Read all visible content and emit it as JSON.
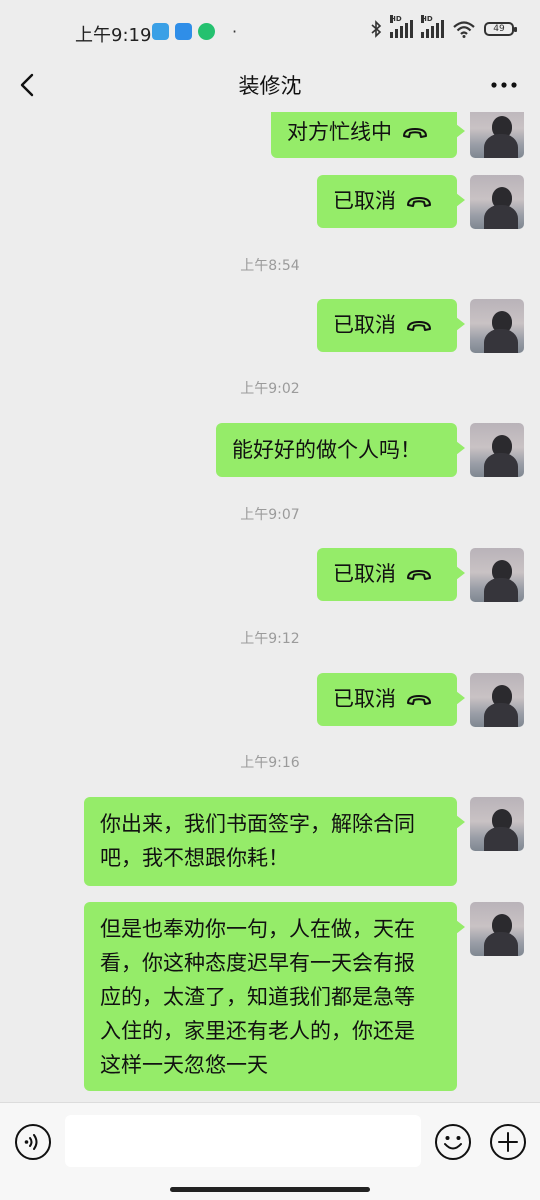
{
  "status_bar": {
    "time": "上午9:19",
    "dot": "·",
    "battery": "49",
    "hd1": "HD",
    "hd2": "HD"
  },
  "header": {
    "title": "装修沈"
  },
  "colors": {
    "bubble_sent": "#95ec69",
    "background": "#ededed"
  },
  "messages": [
    {
      "type": "call",
      "text": "对方忙线中"
    },
    {
      "type": "call",
      "text": "已取消"
    },
    {
      "type": "time",
      "text": "上午8:54"
    },
    {
      "type": "call",
      "text": "已取消"
    },
    {
      "type": "time",
      "text": "上午9:02"
    },
    {
      "type": "text",
      "lines": [
        "能好好的做个人吗！"
      ]
    },
    {
      "type": "time",
      "text": "上午9:07"
    },
    {
      "type": "call",
      "text": "已取消"
    },
    {
      "type": "time",
      "text": "上午9:12"
    },
    {
      "type": "call",
      "text": "已取消"
    },
    {
      "type": "time",
      "text": "上午9:16"
    },
    {
      "type": "text",
      "lines": [
        "你出来，我们书面签字，解除合同",
        "吧，我不想跟你耗！"
      ]
    },
    {
      "type": "text",
      "lines": [
        "但是也奉劝你一句，人在做，天在",
        "看，你这种态度迟早有一天会有报",
        "应的，太渣了，知道我们都是急等",
        "入住的，家里还有老人的，你还是",
        "这样一天忽悠一天"
      ]
    }
  ],
  "input": {
    "value": ""
  },
  "icons": {
    "voice": "voice-icon",
    "emoji": "emoji-icon",
    "add": "plus-icon",
    "back": "back-arrow-icon",
    "more": "more-icon",
    "call": "hangup-phone-icon"
  }
}
